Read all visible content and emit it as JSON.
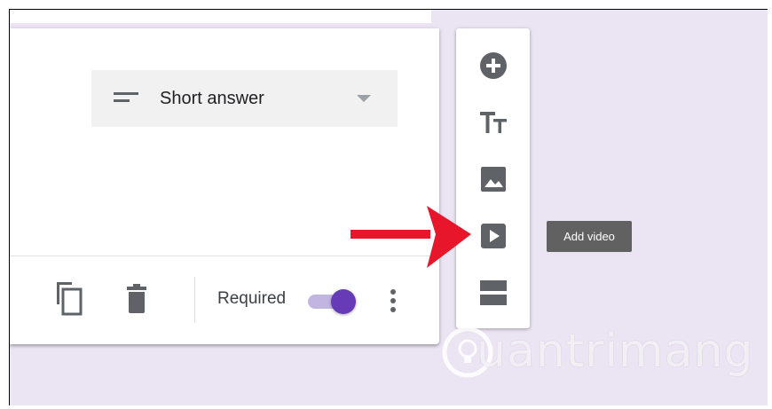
{
  "question_card": {
    "type_dropdown": {
      "selected": "Short answer"
    },
    "footer": {
      "required_label": "Required",
      "required_on": true
    }
  },
  "tool_panel": {
    "items": [
      {
        "icon": "add-circle-icon",
        "tooltip": ""
      },
      {
        "icon": "title-text-icon",
        "tooltip": ""
      },
      {
        "icon": "image-icon",
        "tooltip": ""
      },
      {
        "icon": "video-icon",
        "tooltip": "Add video"
      },
      {
        "icon": "section-icon",
        "tooltip": ""
      }
    ]
  },
  "tooltip": {
    "text": "Add video"
  },
  "watermark": {
    "text": "uantrimang"
  },
  "colors": {
    "background": "#ebe4f3",
    "accent": "#673ab7",
    "accent_track": "#c2b5e2",
    "arrow": "#e8162b",
    "icon": "#5f6368"
  }
}
